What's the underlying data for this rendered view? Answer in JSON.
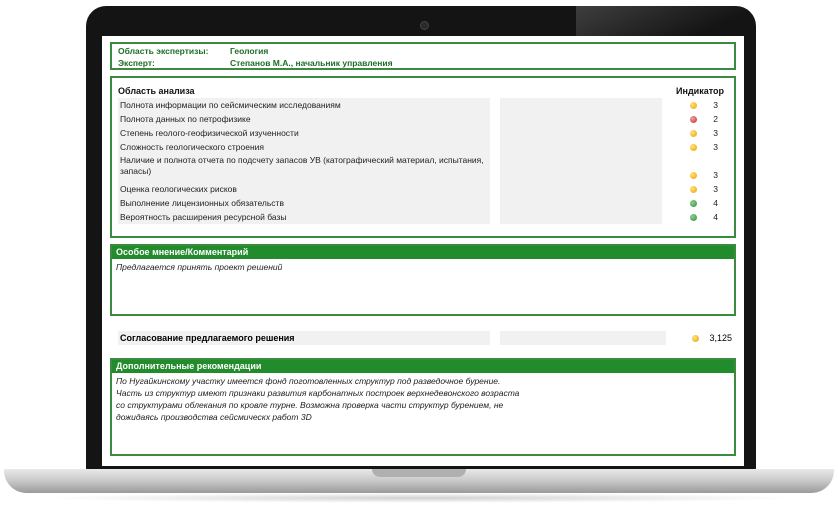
{
  "header": {
    "area_key": "Область экспертизы:",
    "area_value": "Геология",
    "expert_key": "Эксперт:",
    "expert_value": "Степанов М.А., начальник управления"
  },
  "analysis": {
    "title": "Область анализа",
    "indicator_header": "Индикатор",
    "rows": [
      {
        "label": "Полнота информации по сейсмическим исследованиям",
        "status": "yellow",
        "value": "3"
      },
      {
        "label": "Полнота данных по петрофизике",
        "status": "red",
        "value": "2"
      },
      {
        "label": "Степень геолого-геофизической изученности",
        "status": "yellow",
        "value": "3"
      },
      {
        "label": "Сложность геологического строения",
        "status": "yellow",
        "value": "3"
      },
      {
        "label": "Наличие и полнота отчета по подсчету запасов УВ (катографический материал, испытания, запасы)",
        "status": "yellow",
        "value": "3"
      },
      {
        "label": "Оценка геологических рисков",
        "status": "yellow",
        "value": "3"
      },
      {
        "label": "Выполнение лицензионных обязательств",
        "status": "green",
        "value": "4"
      },
      {
        "label": "Вероятность расширения ресурсной базы",
        "status": "green",
        "value": "4"
      }
    ]
  },
  "opinion": {
    "title": "Особое мнение/Комментарий",
    "text": "Предлагается принять проект решений"
  },
  "agreement": {
    "label": "Согласование предлагаемого решения",
    "status": "yellow",
    "value": "3,125"
  },
  "recommendations": {
    "title": "Дополнительные рекомендации",
    "lines": [
      "По Нугайкинскому участку имеется фонд поготовленных структур под разведочное бурение.",
      "Часть из структур имеют признаки развития карбонатных построек верхнедевонского возраста",
      "со структурами облекания по кровле турне. Возможна проверка части структур бурением, не",
      "дожидаясь производства сейсмическх работ 3D"
    ]
  },
  "colors": {
    "accent_green": "#228b2c",
    "status_yellow": "#e8a400",
    "status_red": "#c62c2c",
    "status_green": "#2f8f3a"
  }
}
